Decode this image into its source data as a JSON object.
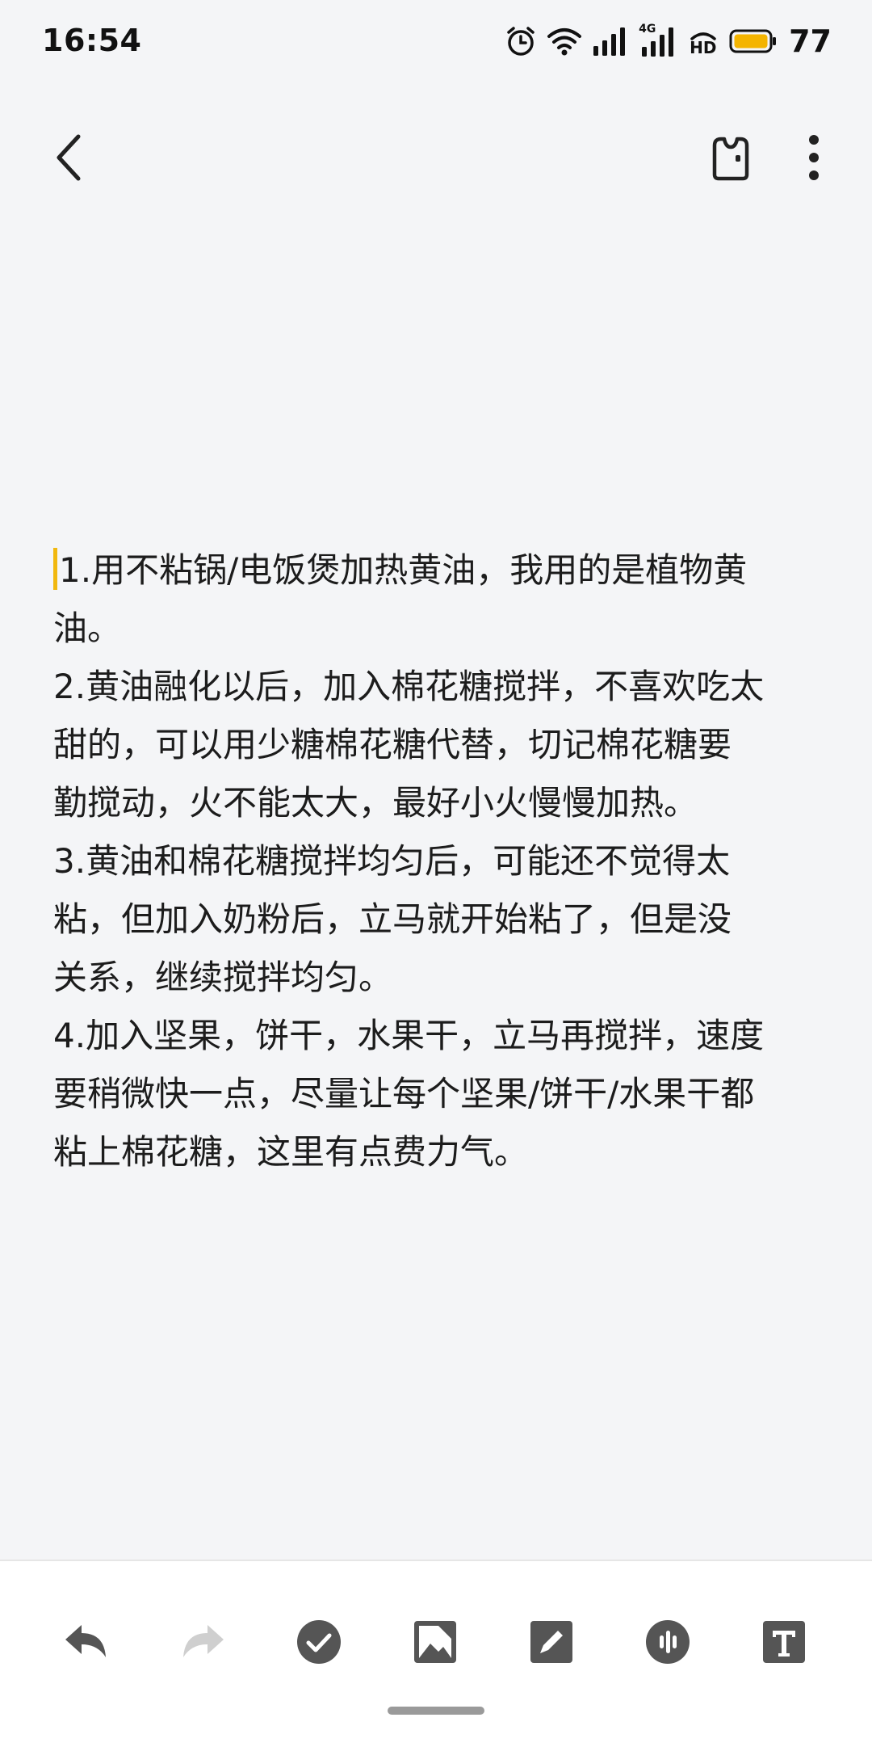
{
  "status_bar": {
    "time": "16:54",
    "network_label": "4G",
    "hd_label": "HD",
    "battery": "77",
    "icons": [
      "alarm-icon",
      "wifi-icon",
      "signal-icon",
      "signal-4g-icon",
      "hd-icon",
      "battery-icon"
    ],
    "battery_color": "#f4b400"
  },
  "app_bar": {
    "back_icon": "chevron-left-icon",
    "bag_icon": "bag-icon",
    "more_icon": "more-vertical-icon"
  },
  "note": {
    "lines": [
      "1.用不粘锅/电饭煲加热黄油，我用的是植物黄",
      "油。",
      "2.黄油融化以后，加入棉花糖搅拌，不喜欢吃太",
      "甜的，可以用少糖棉花糖代替，切记棉花糖要",
      "勤搅动，火不能太大，最好小火慢慢加热。",
      "3.黄油和棉花糖搅拌均匀后，可能还不觉得太",
      "粘，但加入奶粉后，立马就开始粘了，但是没",
      "关系，继续搅拌均匀。",
      "4.加入坚果，饼干，水果干，立马再搅拌，速度",
      "要稍微快一点，尽量让每个坚果/饼干/水果干都",
      "粘上棉花糖，这里有点费力气。"
    ],
    "caret_color": "#f1b80f"
  },
  "toolbar": {
    "tools": [
      "undo-icon",
      "redo-icon",
      "checklist-icon",
      "image-icon",
      "draw-icon",
      "audio-icon",
      "text-format-icon"
    ],
    "redo_disabled": true
  }
}
